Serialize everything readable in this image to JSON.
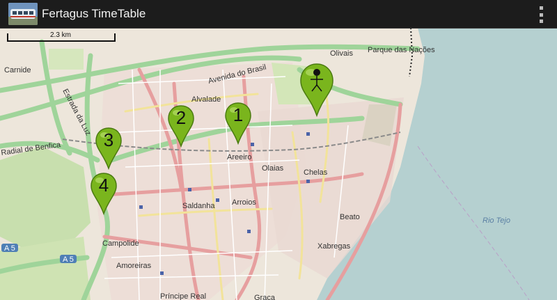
{
  "app": {
    "title": "Fertagus TimeTable"
  },
  "map": {
    "scale_label": "2.3 km",
    "place_labels": [
      "Carnide",
      "Olivais",
      "Parque das Nações",
      "Alvalade",
      "Avenida do Brasil",
      "Areeiro",
      "Olaias",
      "Chelas",
      "Saldanha",
      "Arroios",
      "Beato",
      "Rio Tejo",
      "Xabregas",
      "Campolide",
      "Amoreiras",
      "Príncipe Real",
      "Graça",
      "Estrada da Luz",
      "Radial de Benfica",
      "A 5",
      "A 5"
    ],
    "markers": [
      {
        "label": "1",
        "color": "#7ab51d"
      },
      {
        "label": "2",
        "color": "#7ab51d"
      },
      {
        "label": "3",
        "color": "#7ab51d"
      },
      {
        "label": "4",
        "color": "#7ab51d"
      }
    ],
    "user_marker": {
      "icon": "person-icon",
      "color": "#7ab51d"
    }
  },
  "colors": {
    "actionbar": "#1c1c1c",
    "water": "#b5d0d0",
    "pin": "#7ab51d"
  }
}
